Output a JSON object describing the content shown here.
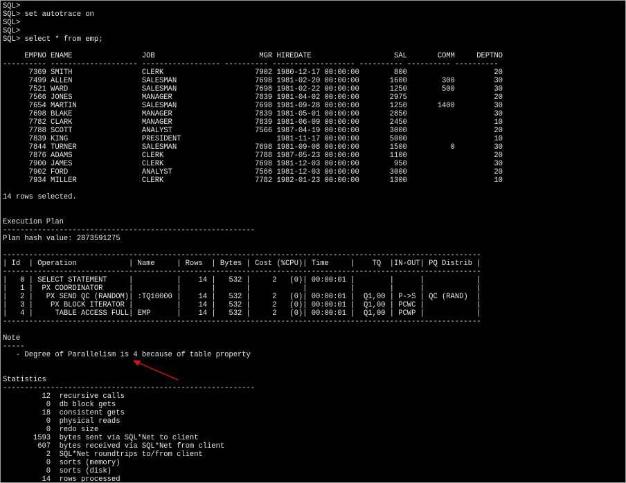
{
  "window": {
    "background": "#000000",
    "text_color": "#e6e6e6",
    "annotation_color": "#e01010"
  },
  "lines": [
    "SQL>",
    "SQL> set autotrace on",
    "SQL>",
    "SQL>",
    "SQL> select * from emp;",
    "",
    "     EMPNO ENAME                JOB                        MGR HIREDATE                   SAL       COMM     DEPTNO",
    "---------- -------------------- ------------------ ---------- ------------------- ---------- ---------- ----------",
    "      7369 SMITH                CLERK                     7902 1980-12-17 00:00:00        800                    20",
    "      7499 ALLEN                SALESMAN                  7698 1981-02-20 00:00:00       1600        300         30",
    "      7521 WARD                 SALESMAN                  7698 1981-02-22 00:00:00       1250        500         30",
    "      7566 JONES                MANAGER                   7839 1981-04-02 00:00:00       2975                    20",
    "      7654 MARTIN               SALESMAN                  7698 1981-09-28 00:00:00       1250       1400         30",
    "      7698 BLAKE                MANAGER                   7839 1981-05-01 00:00:00       2850                    30",
    "      7782 CLARK                MANAGER                   7839 1981-06-09 00:00:00       2450                    10",
    "      7788 SCOTT                ANALYST                   7566 1987-04-19 00:00:00       3000                    20",
    "      7839 KING                 PRESIDENT                      1981-11-17 00:00:00       5000                    10",
    "      7844 TURNER               SALESMAN                  7698 1981-09-08 00:00:00       1500          0         30",
    "      7876 ADAMS                CLERK                     7788 1987-05-23 00:00:00       1100                    20",
    "      7900 JAMES                CLERK                     7698 1981-12-03 00:00:00        950                    30",
    "      7902 FORD                 ANALYST                   7566 1981-12-03 00:00:00       3000                    20",
    "      7934 MILLER               CLERK                     7782 1982-01-23 00:00:00       1300                    10",
    "",
    "14 rows selected.",
    "",
    "",
    "Execution Plan",
    "----------------------------------------------------------",
    "Plan hash value: 2873591275",
    "",
    "--------------------------------------------------------------------------------------------------------------",
    "| Id  | Operation            | Name     | Rows  | Bytes | Cost (%CPU)| Time     |    TQ  |IN-OUT| PQ Distrib |",
    "--------------------------------------------------------------------------------------------------------------",
    "|   0 | SELECT STATEMENT     |          |    14 |   532 |     2   (0)| 00:00:01 |        |      |            |",
    "|   1 |  PX COORDINATOR      |          |       |       |            |          |        |      |            |",
    "|   2 |   PX SEND QC (RANDOM)| :TQ10000 |    14 |   532 |     2   (0)| 00:00:01 |  Q1,00 | P->S | QC (RAND)  |",
    "|   3 |    PX BLOCK ITERATOR |          |    14 |   532 |     2   (0)| 00:00:01 |  Q1,00 | PCWC |            |",
    "|   4 |     TABLE ACCESS FULL| EMP      |    14 |   532 |     2   (0)| 00:00:01 |  Q1,00 | PCWP |            |",
    "--------------------------------------------------------------------------------------------------------------",
    "",
    "Note",
    "-----",
    "   - Degree of Parallelism is 4 because of table property",
    "",
    "",
    "Statistics",
    "----------------------------------------------------------",
    "         12  recursive calls",
    "          0  db block gets",
    "         18  consistent gets",
    "          0  physical reads",
    "          0  redo size",
    "       1593  bytes sent via SQL*Net to client",
    "        607  bytes received via SQL*Net from client",
    "          2  SQL*Net roundtrips to/from client",
    "          0  sorts (memory)",
    "          0  sorts (disk)",
    "         14  rows processed"
  ]
}
